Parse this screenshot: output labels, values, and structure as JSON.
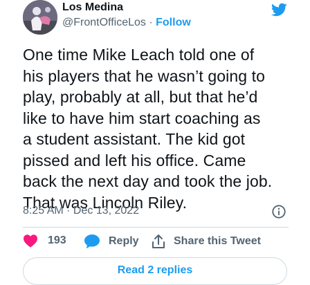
{
  "author": {
    "name": "Los Medina",
    "handle": "@FrontOfficeLos",
    "separator": "·",
    "follow_label": "Follow"
  },
  "tweet": {
    "text": "One time Mike Leach told one of\nhis players that he wasn’t going to\nplay, probably at all, but that he’d\nlike to have him start coaching as\na student assistant. The kid got\npissed and left his office. Came\nback the next day and took the job.\nThat was Lincoln Riley.",
    "timestamp": "8:25 AM · Dec 13, 2022"
  },
  "actions": {
    "like_count": "193",
    "reply_label": "Reply",
    "share_label": "Share this Tweet"
  },
  "footer": {
    "read_replies_label": "Read 2 replies"
  },
  "icons": {
    "brand": "twitter-bird-icon",
    "info": "info-icon",
    "like": "heart-icon",
    "reply": "speech-bubble-icon",
    "share": "share-icon"
  },
  "colors": {
    "accent": "#1d9bf0",
    "like": "#f91880",
    "text": "#0f1419",
    "secondary": "#536471",
    "border": "#cfd9de"
  }
}
